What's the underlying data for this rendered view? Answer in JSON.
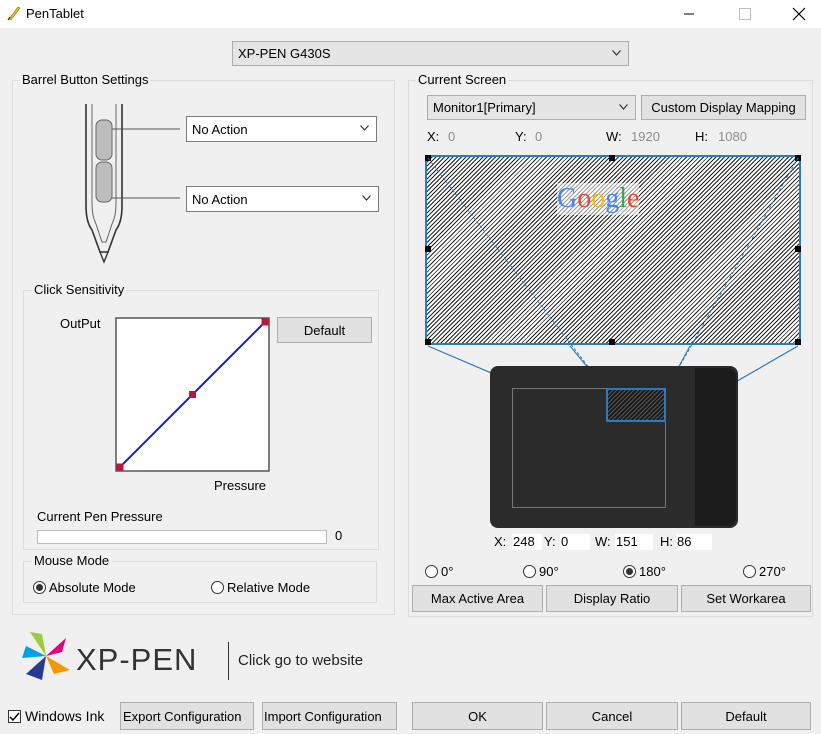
{
  "window": {
    "title": "PenTablet",
    "icon": "pen-tablet-app-icon",
    "controls": [
      "minimize-icon",
      "maximize-icon",
      "close-icon"
    ]
  },
  "device": {
    "selected": "XP-PEN G430S"
  },
  "barrel": {
    "title": "Barrel Button Settings",
    "button1": "No Action",
    "button2": "No Action"
  },
  "sensitivity": {
    "title": "Click Sensitivity",
    "output_label": "OutPut",
    "pressure_label": "Pressure",
    "default_button": "Default",
    "current_label": "Current Pen Pressure",
    "current_value": "0",
    "current_fraction": 0,
    "curve_points": [
      [
        0,
        0
      ],
      [
        0.5,
        0.5
      ],
      [
        1,
        1
      ]
    ]
  },
  "mouse_mode": {
    "title": "Mouse Mode",
    "absolute": "Absolute Mode",
    "relative": "Relative Mode",
    "selected": "absolute"
  },
  "screen": {
    "title": "Current Screen",
    "monitor": "Monitor1[Primary]",
    "custom_mapping": "Custom Display Mapping",
    "x_label": "X:",
    "x": "0",
    "y_label": "Y:",
    "y": "0",
    "w_label": "W:",
    "w": "1920",
    "h_label": "H:",
    "h": "1080",
    "preview_logo": "Google"
  },
  "tablet_area": {
    "x_label": "X:",
    "x": "248",
    "y_label": "Y:",
    "y": "0",
    "w_label": "W:",
    "w": "151",
    "h_label": "H:",
    "h": "86"
  },
  "rotation": {
    "options": [
      "0°",
      "90°",
      "180°",
      "270°"
    ],
    "selected": "180°"
  },
  "area_buttons": {
    "max": "Max Active Area",
    "ratio": "Display Ratio",
    "set": "Set Workarea"
  },
  "brand": {
    "name": "XP-PEN",
    "link": "Click go to website"
  },
  "footer": {
    "windows_ink": "Windows Ink",
    "windows_ink_checked": true,
    "export": "Export Configuration",
    "import": "Import Configuration",
    "ok": "OK",
    "cancel": "Cancel",
    "default": "Default"
  },
  "colors": {
    "curve": "#0a20d8",
    "curve_point": "#c0143c",
    "selection": "#2a7bbf",
    "brand_text": "#333333"
  }
}
